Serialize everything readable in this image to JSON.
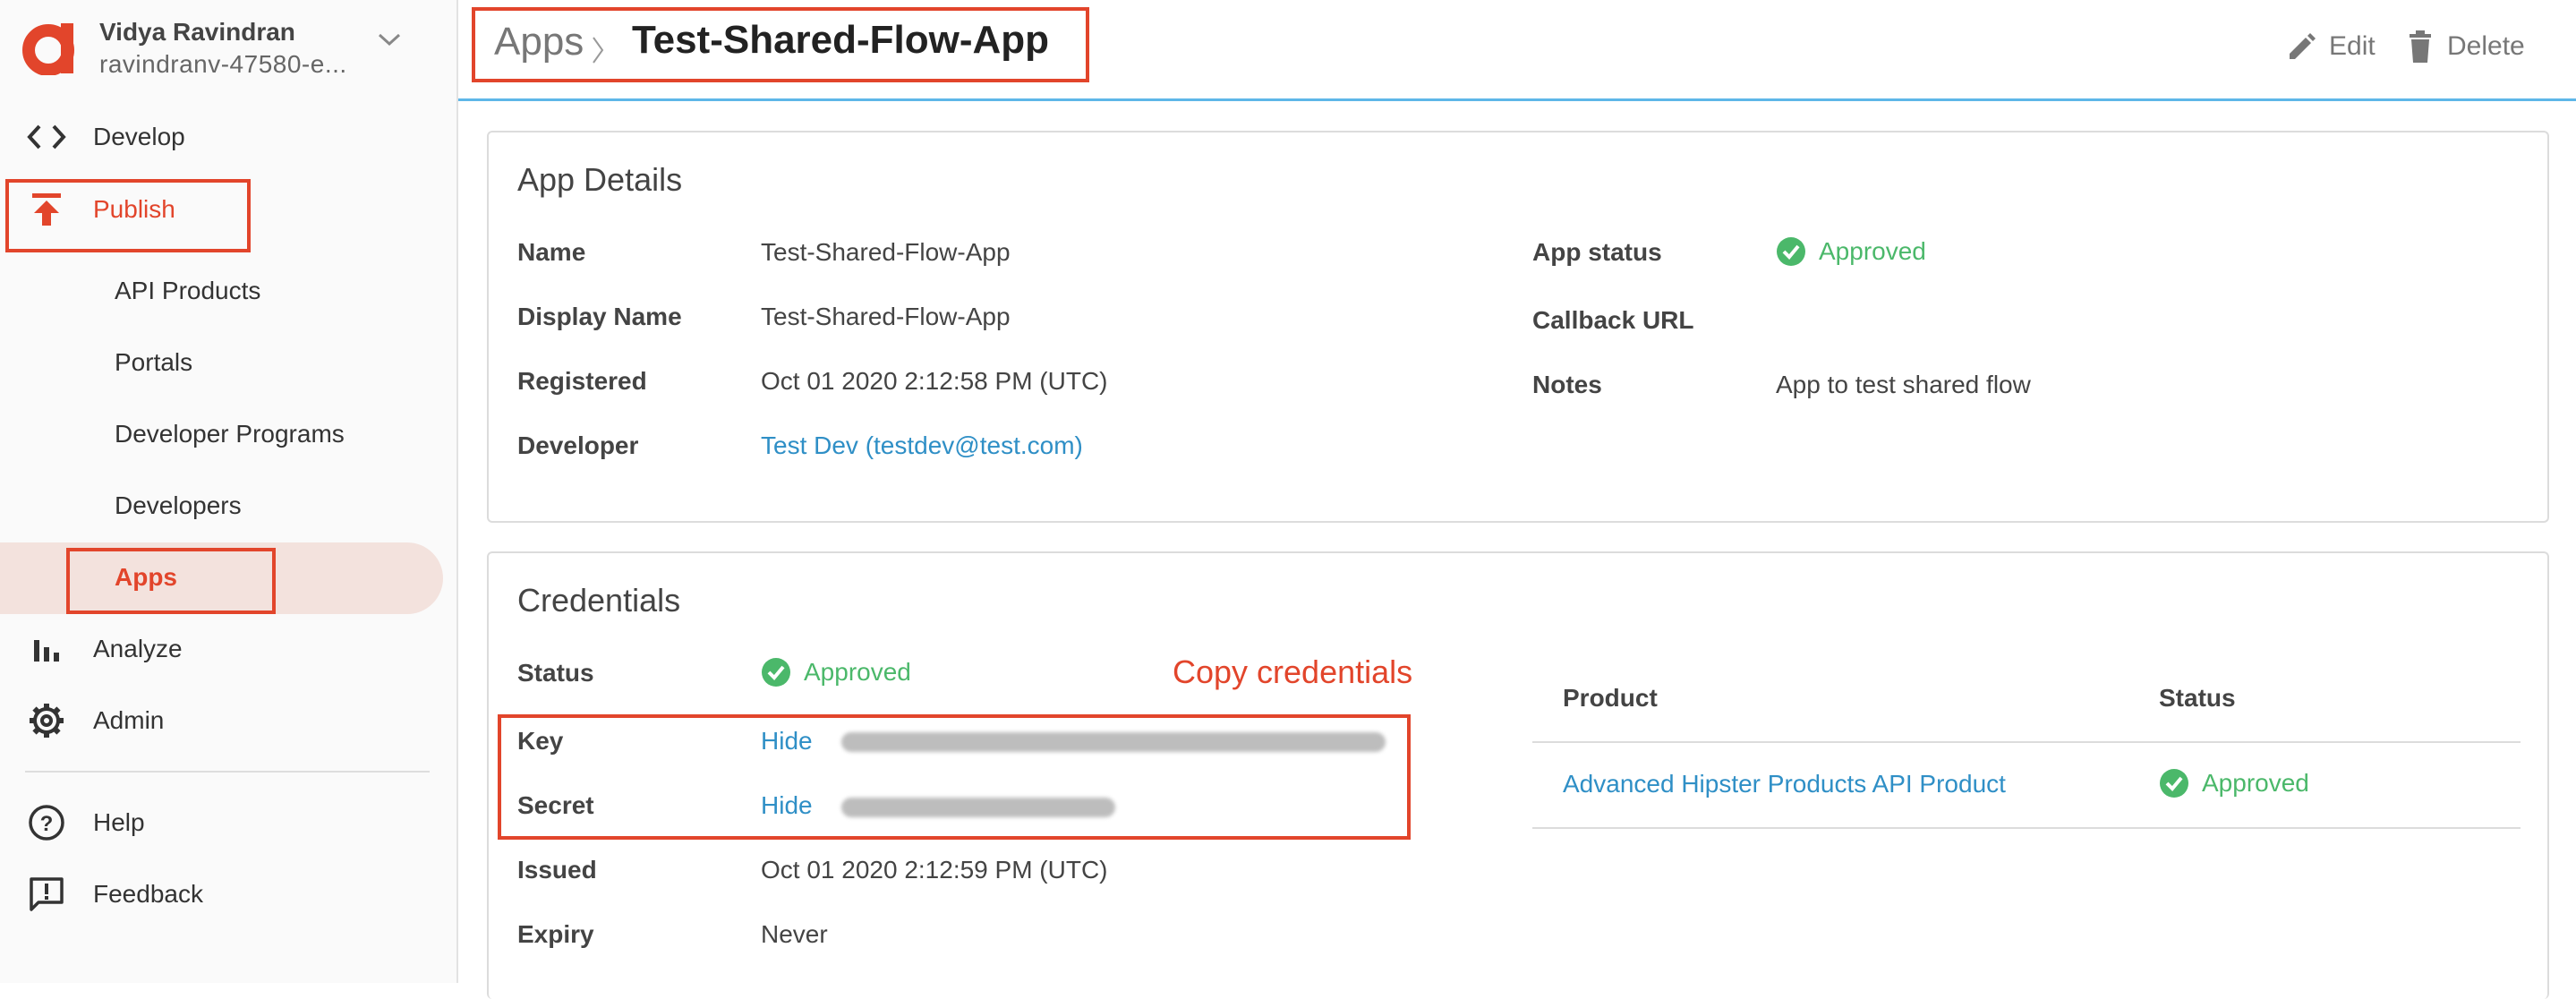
{
  "user": {
    "name": "Vidya Ravindran",
    "org": "ravindranv-47580-e..."
  },
  "sidebar": {
    "develop": "Develop",
    "publish": "Publish",
    "sub_items": [
      "API Products",
      "Portals",
      "Developer Programs",
      "Developers",
      "Apps"
    ],
    "analyze": "Analyze",
    "admin": "Admin",
    "help": "Help",
    "feedback": "Feedback"
  },
  "header": {
    "breadcrumb_root": "Apps",
    "title": "Test-Shared-Flow-App",
    "edit": "Edit",
    "delete": "Delete"
  },
  "app_details": {
    "title": "App Details",
    "left": [
      {
        "label": "Name",
        "value": "Test-Shared-Flow-App"
      },
      {
        "label": "Display Name",
        "value": "Test-Shared-Flow-App"
      },
      {
        "label": "Registered",
        "value": "Oct 01 2020 2:12:58 PM (UTC)"
      },
      {
        "label": "Developer",
        "value": "Test Dev (testdev@test.com)"
      }
    ],
    "right": [
      {
        "label": "App status",
        "value": "Approved"
      },
      {
        "label": "Callback URL",
        "value": ""
      },
      {
        "label": "Notes",
        "value": "App to test shared flow"
      }
    ]
  },
  "credentials": {
    "title": "Credentials",
    "status_label": "Status",
    "status_value": "Approved",
    "annotation": "Copy credentials",
    "key_label": "Key",
    "key_toggle": "Hide",
    "secret_label": "Secret",
    "secret_toggle": "Hide",
    "issued_label": "Issued",
    "issued_value": "Oct 01 2020 2:12:59 PM (UTC)",
    "expiry_label": "Expiry",
    "expiry_value": "Never",
    "table": {
      "headers": [
        "Product",
        "Status"
      ],
      "rows": [
        {
          "product": "Advanced Hipster Products API Product",
          "status": "Approved"
        }
      ]
    }
  },
  "colors": {
    "accent_red": "#e2452b",
    "link_blue": "#2f8fc6",
    "approved_green": "#4bb86a",
    "header_border": "#5eb7e8"
  }
}
